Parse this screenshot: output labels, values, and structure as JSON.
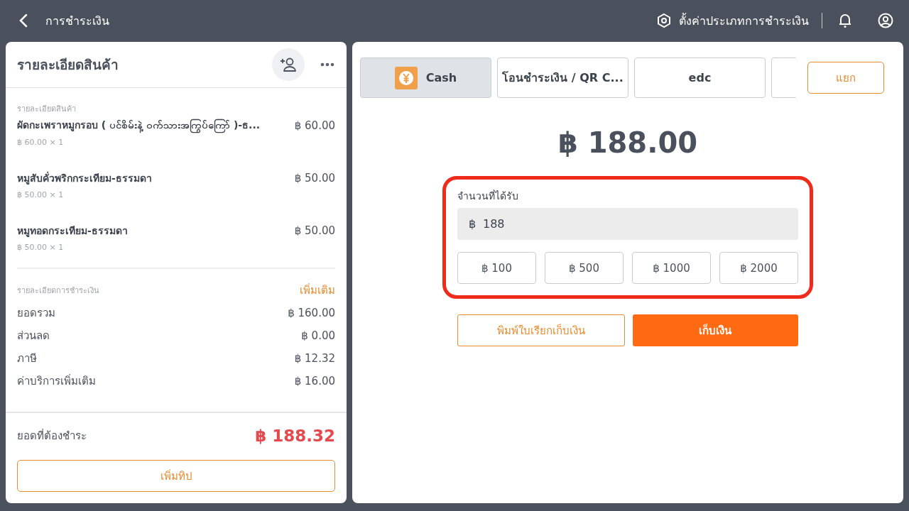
{
  "top_bar": {
    "title": "การชำระเงิน",
    "settings_label": "ตั้งค่าประเภทการชำระเงิน"
  },
  "order_panel": {
    "title": "รายละเอียดสินค้า",
    "items": [
      {
        "section_label": "รายละเอียดสินค้า",
        "name": "ผัดกะเพราหมูกรอบ ( ပင်စိမ်းနဲ့ ဝက်သားအကြွပ်ကြော် )-ธ...",
        "price": "฿ 60.00",
        "unit": "฿ 60.00 × 1"
      },
      {
        "name": "หมูสับคั่วพริกกระเทียม-ธรรมดา",
        "price": "฿ 50.00",
        "unit": "฿ 50.00 × 1"
      },
      {
        "name": "หมูทอดกระเทียม-ธรรมดา",
        "price": "฿ 50.00",
        "unit": "฿ 50.00 × 1"
      }
    ],
    "payment_details": {
      "label": "รายละเอียดการชำระเงิน",
      "more_link": "เพิ่มเติม",
      "rows": [
        {
          "label": "ยอดรวม",
          "value": "฿ 160.00"
        },
        {
          "label": "ส่วนลด",
          "value": "฿ 0.00"
        },
        {
          "label": "ภาษี",
          "value": "฿ 12.32"
        },
        {
          "label": "ค่าบริการเพิ่มเติม",
          "value": "฿ 16.00"
        }
      ]
    },
    "due_label": "ยอดที่ต้องชำระ",
    "due_amount": "฿ 188.32",
    "tip_button": "เพิ่มทิป"
  },
  "payment_panel": {
    "methods": [
      {
        "label": "Cash",
        "kind": "cash",
        "selected": true
      },
      {
        "label": "โอนชำระเงิน / QR C...",
        "kind": "text",
        "selected": false
      },
      {
        "label": "edc",
        "kind": "text",
        "selected": false
      },
      {
        "kind": "blank",
        "selected": false
      }
    ],
    "split_button": "แยก",
    "amount": "฿ 188.00",
    "received": {
      "label": "จำนวนที่ได้รับ",
      "currency": "฿",
      "value": "188",
      "quick_amounts": [
        "฿ 100",
        "฿ 500",
        "฿ 1000",
        "฿ 2000"
      ]
    },
    "print_button": "พิมพ์ใบเรียกเก็บเงิน",
    "collect_button": "เก็บเงิน"
  }
}
